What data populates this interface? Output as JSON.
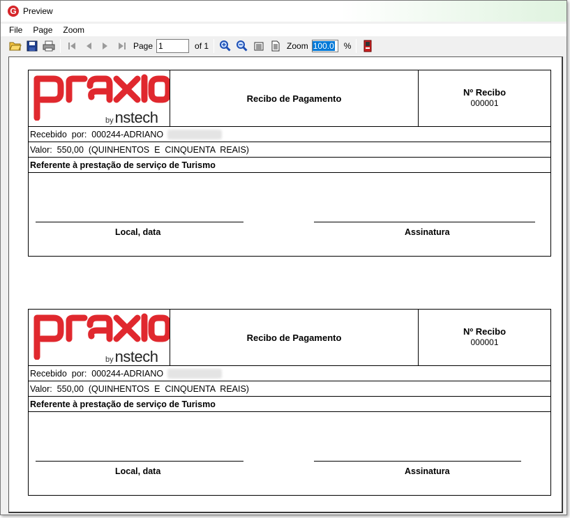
{
  "window": {
    "title": "Preview",
    "app_icon_letter": "G"
  },
  "menu": {
    "items": [
      "File",
      "Page",
      "Zoom"
    ]
  },
  "toolbar": {
    "page_label": "Page",
    "page_value": "1",
    "of_label": "of 1",
    "zoom_label": "Zoom",
    "zoom_value": "100.0",
    "percent": "%",
    "icons": [
      "open-folder-icon",
      "save-icon",
      "print-icon",
      "first-page-icon",
      "prev-page-icon",
      "next-page-icon",
      "last-page-icon",
      "zoom-in-icon",
      "zoom-out-icon",
      "page-width-icon",
      "whole-page-icon",
      "exit-icon"
    ]
  },
  "receipts": [
    {
      "logo_brand": "praxio",
      "logo_by": "by",
      "logo_company": "nstech",
      "title": "Recibo de Pagamento",
      "number_label": "Nº Recibo",
      "number_value": "000001",
      "recebido": "Recebido  por:  000244-ADRIANO",
      "valor": "Valor:  550,00  (QUINHENTOS  E  CINQUENTA  REAIS)",
      "referente": "Referente à prestação de serviço de Turismo",
      "local_label": "Local, data",
      "assinatura_label": "Assinatura"
    },
    {
      "logo_brand": "praxio",
      "logo_by": "by",
      "logo_company": "nstech",
      "title": "Recibo de Pagamento",
      "number_label": "Nº Recibo",
      "number_value": "000001",
      "recebido": "Recebido  por:  000244-ADRIANO",
      "valor": "Valor:  550,00  (QUINHENTOS  E  CINQUENTA  REAIS)",
      "referente": "Referente à prestação de serviço de Turismo",
      "local_label": "Local, data",
      "assinatura_label": "Assinatura"
    }
  ],
  "colors": {
    "brand_red": "#e0282e",
    "highlight": "#0078d7"
  }
}
